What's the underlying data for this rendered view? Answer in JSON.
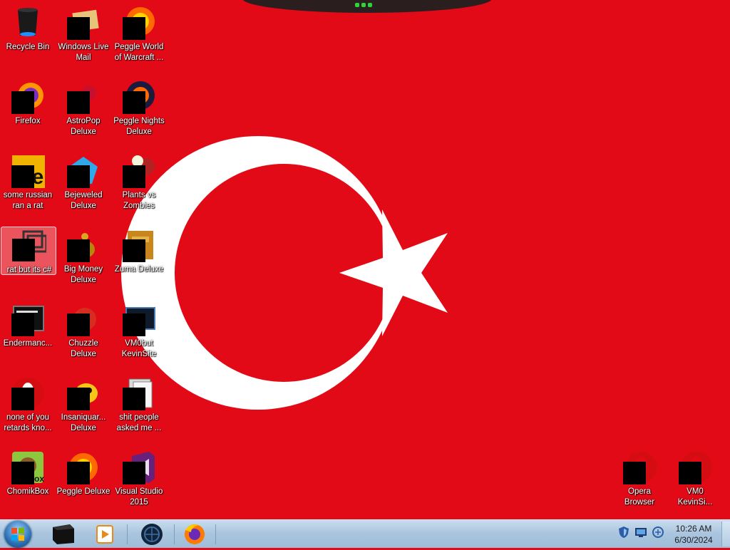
{
  "wallpaper": {
    "name": "turkish-flag",
    "colors": {
      "red": "#e30a17",
      "white": "#ffffff"
    }
  },
  "desktop_icons": [
    {
      "id": "recycle-bin",
      "label": "Recycle Bin",
      "icon": "recycle-bin-icon",
      "censored": false
    },
    {
      "id": "windows-live-mail",
      "label": "Windows Live\nMail",
      "icon": "mail-icon",
      "censored": true
    },
    {
      "id": "peggle-wow",
      "label": "Peggle World\nof Warcraft ...",
      "icon": "peggle-icon",
      "censored": true
    },
    {
      "id": "firefox",
      "label": "Firefox",
      "icon": "firefox-icon",
      "censored": true
    },
    {
      "id": "astropop",
      "label": "AstroPop\nDeluxe",
      "icon": "astropop-icon",
      "censored": true
    },
    {
      "id": "peggle-nights",
      "label": "Peggle Nights\nDeluxe",
      "icon": "peggle-nights-icon",
      "censored": true
    },
    {
      "id": "some-russian",
      "label": "some russian\nran a rat",
      "icon": "app-icon",
      "censored": true
    },
    {
      "id": "bejeweled",
      "label": "Bejeweled\nDeluxe",
      "icon": "bejeweled-icon",
      "censored": true
    },
    {
      "id": "pvz",
      "label": "Plants vs\nZombies",
      "icon": "pvz-icon",
      "censored": true
    },
    {
      "id": "rat-csharp",
      "label": "rat but its c#",
      "icon": "shortcut-icon",
      "censored": true
    },
    {
      "id": "big-money",
      "label": "Big Money\nDeluxe",
      "icon": "big-money-icon",
      "censored": true
    },
    {
      "id": "zuma",
      "label": "Zuma Deluxe",
      "icon": "zuma-icon",
      "censored": true
    },
    {
      "id": "endermanch",
      "label": "Endermanc...",
      "icon": "terminal-icon",
      "censored": true
    },
    {
      "id": "chuzzle",
      "label": "Chuzzle\nDeluxe",
      "icon": "chuzzle-icon",
      "censored": true
    },
    {
      "id": "vm0but",
      "label": "VM0but\nKevinSite",
      "icon": "vm-icon",
      "censored": true
    },
    {
      "id": "none-of-you",
      "label": "none of you\nretards kno...",
      "icon": "opera-icon",
      "censored": true
    },
    {
      "id": "insaniquarium",
      "label": "Insaniquar...\nDeluxe",
      "icon": "insaniquarium-icon",
      "censored": true
    },
    {
      "id": "people-asked",
      "label": "shit people\nasked me ...",
      "icon": "folder-icon",
      "censored": true
    },
    {
      "id": "chomikbox",
      "label": "ChomikBox",
      "icon": "chomikbox-icon",
      "censored": true
    },
    {
      "id": "peggle-deluxe",
      "label": "Peggle Deluxe",
      "icon": "peggle-icon",
      "censored": true
    },
    {
      "id": "visual-studio",
      "label": "Visual Studio\n2015",
      "icon": "visual-studio-icon",
      "censored": true
    },
    {
      "id": "opera-browser",
      "label": "Opera\nBrowser",
      "icon": "opera-icon",
      "censored": true
    },
    {
      "id": "vm0-kevinsi",
      "label": "VM0\nKevinSi...",
      "icon": "opera-icon",
      "censored": true
    }
  ],
  "taskbar": {
    "pinned": [
      {
        "id": "start",
        "icon": "windows-logo-icon"
      },
      {
        "id": "app1",
        "icon": "black-box-icon"
      },
      {
        "id": "media-player",
        "icon": "media-player-icon"
      },
      {
        "id": "globe-app",
        "icon": "globe-icon"
      },
      {
        "id": "firefox",
        "icon": "firefox-icon"
      }
    ],
    "tray": [
      {
        "id": "tray-1",
        "icon": "shield-tray-icon"
      },
      {
        "id": "tray-2",
        "icon": "network-tray-icon"
      },
      {
        "id": "tray-3",
        "icon": "volume-tray-icon"
      }
    ],
    "clock": {
      "time": "10:26 AM",
      "date": "6/30/2024"
    }
  }
}
